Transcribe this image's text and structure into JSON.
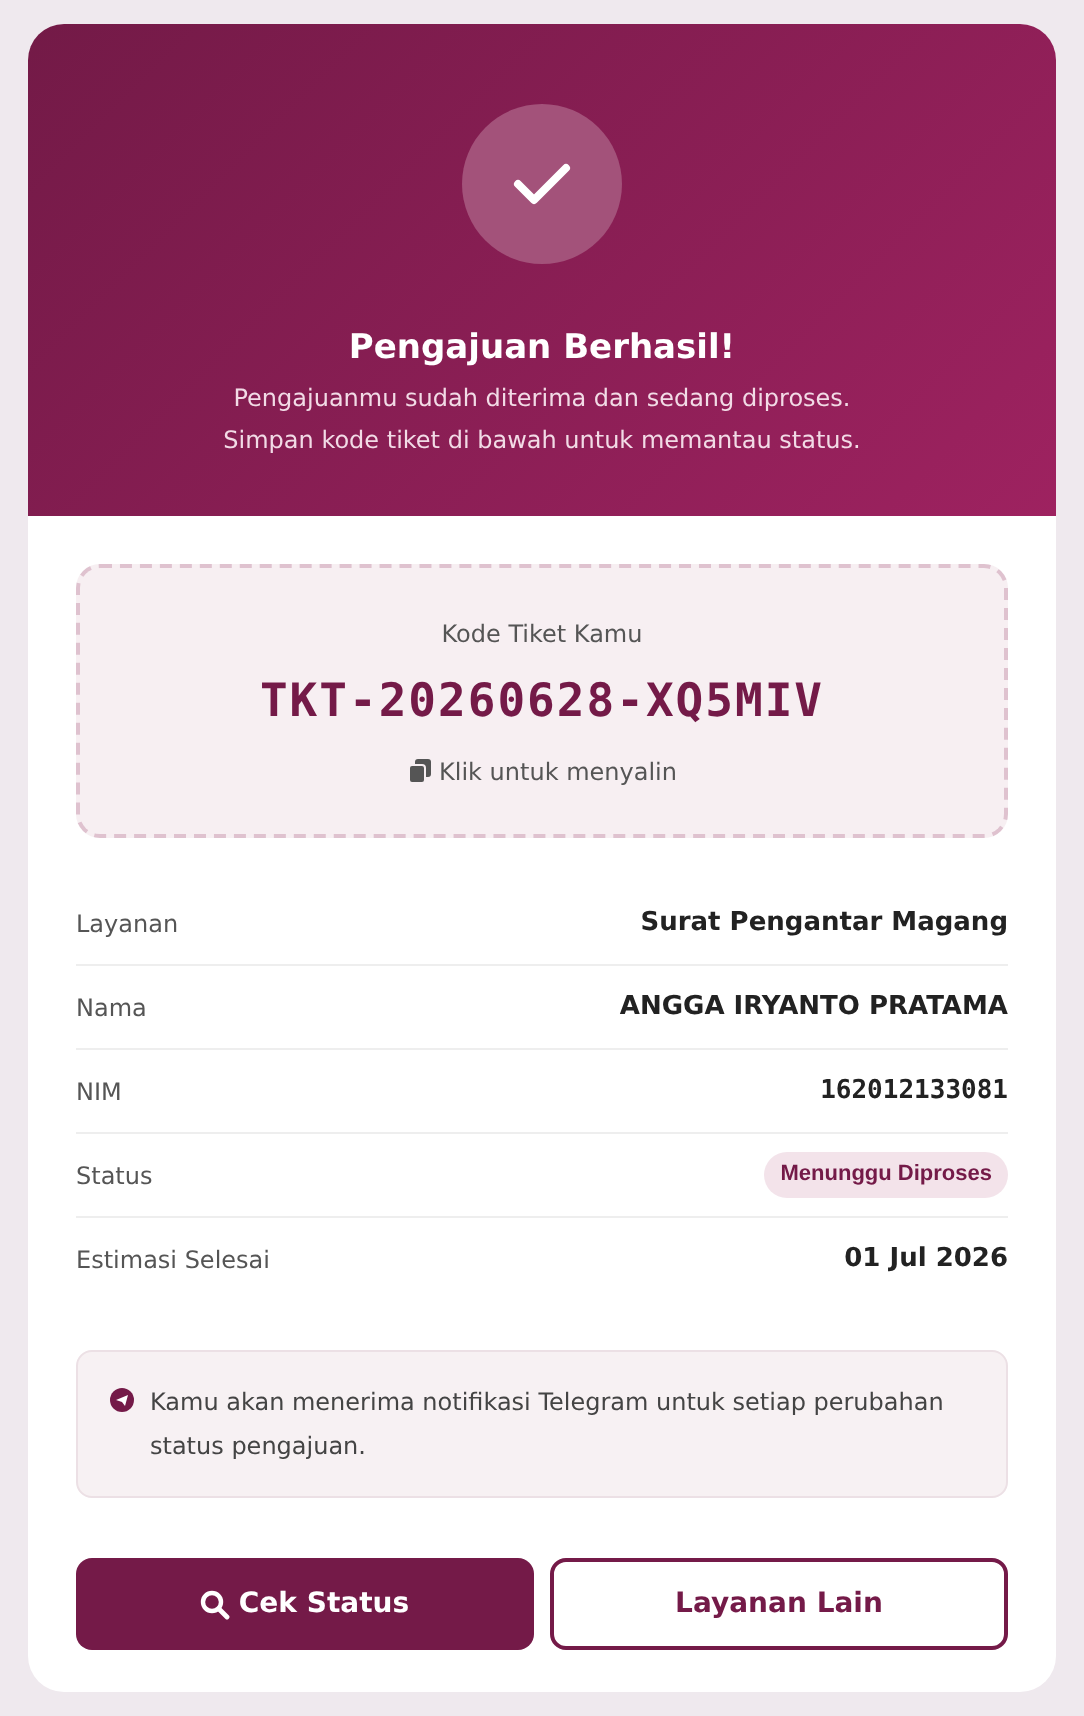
{
  "header": {
    "title": "Pengajuan Berhasil!",
    "lines": [
      "Pengajuanmu sudah diterima dan sedang diproses.",
      "Simpan kode tiket di bawah untuk memantau status."
    ]
  },
  "ticket": {
    "label": "Kode Tiket Kamu",
    "code": "TKT-20260628-XQ5MIV",
    "copy_hint": "Klik untuk menyalin"
  },
  "details": [
    {
      "label": "Layanan",
      "value": "Surat Pengantar Magang",
      "kind": "text"
    },
    {
      "label": "Nama",
      "value": "ANGGA IRYANTO PRATAMA",
      "kind": "text"
    },
    {
      "label": "NIM",
      "value": "162012133081",
      "kind": "mono"
    },
    {
      "label": "Status",
      "value": "Menunggu Diproses",
      "kind": "badge"
    },
    {
      "label": "Estimasi Selesai",
      "value": "01 Jul 2026",
      "kind": "bold"
    }
  ],
  "notice": "Kamu akan menerima notifikasi Telegram untuk setiap perubahan status pengajuan.",
  "buttons": [
    {
      "label": "Cek Status",
      "kind": "primary"
    },
    {
      "label": "Layanan Lain",
      "kind": "outline"
    }
  ]
}
